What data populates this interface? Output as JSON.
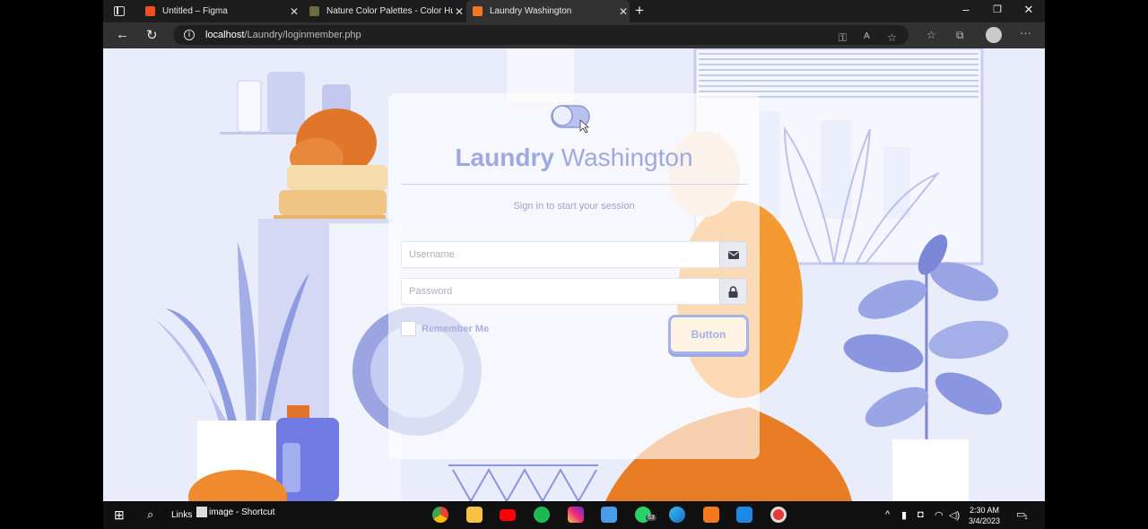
{
  "browser": {
    "tabs": [
      {
        "title": "Untitled – Figma",
        "favicon_color": "#f24e1e",
        "active": false
      },
      {
        "title": "Nature Color Palettes - Color Hu",
        "favicon_color": "#6b6b3b",
        "active": false
      },
      {
        "title": "Laundry Washington",
        "favicon_color": "#f2791d",
        "active": true
      }
    ],
    "url_host": "localhost",
    "url_path": "/Laundry/loginmember.php"
  },
  "login": {
    "title_bold": "Laundry",
    "title_rest": " Washington",
    "subtitle": "Sign in to start your session",
    "username_placeholder": "Username",
    "password_placeholder": "Password",
    "remember_label": "Remember Me",
    "button_label": "Button",
    "accent_color": "#9ea9e3"
  },
  "taskbar": {
    "links_label": "Links",
    "shortcut_label": "image - Shortcut",
    "whatsapp_badge": "63",
    "time": "2:30 AM",
    "date": "3/4/2023",
    "notification_count": "1",
    "apps": [
      "chrome",
      "file-explorer",
      "youtube",
      "spotify",
      "instagram",
      "microsoft-store",
      "whatsapp",
      "edge",
      "xampp",
      "vscode",
      "recorder"
    ]
  }
}
